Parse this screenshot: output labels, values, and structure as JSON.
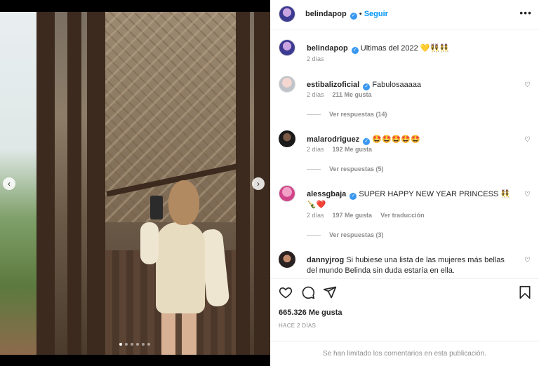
{
  "post": {
    "username": "belindapop",
    "follow_label": "Seguir",
    "more_label": "•••",
    "caption": "Ultimas del 2022 💛👯‍♀️👯",
    "caption_age": "2 días"
  },
  "carousel": {
    "dots": 6,
    "active_dot": 0
  },
  "comments": [
    {
      "username": "estibalizoficial",
      "verified": true,
      "text": "Fabulosaaaaa",
      "age": "2 días",
      "likes": "211 Me gusta",
      "translate": "",
      "replies": "Ver respuestas (14)"
    },
    {
      "username": "malarodriguez",
      "verified": true,
      "text": "🤩🤩🤩🤩🤩",
      "age": "2 días",
      "likes": "192 Me gusta",
      "translate": "",
      "replies": "Ver respuestas (5)"
    },
    {
      "username": "alessgbaja",
      "verified": true,
      "text": "SUPER HAPPY NEW YEAR PRINCESS 👯🍾❤️",
      "age": "2 días",
      "likes": "197 Me gusta",
      "translate": "Ver traducción",
      "replies": "Ver respuestas (3)"
    },
    {
      "username": "dannyjrog",
      "verified": false,
      "text": "Si hubiese una lista de las mujeres más bellas del mundo Belinda sin duda estaría en ella.",
      "age": "",
      "likes": "",
      "translate": "",
      "replies": ""
    }
  ],
  "footer": {
    "likes": "665.326 Me gusta",
    "ago": "HACE 2 DÍAS",
    "limited": "Se han limitado los comentarios en esta publicación."
  },
  "icons": {
    "like": "heart-outline",
    "comment": "speech-bubble",
    "share": "paper-plane",
    "save": "bookmark",
    "verified": "check-badge"
  },
  "colors": {
    "accent": "#0095f6",
    "verified": "#3897f0",
    "muted": "#8e8e8e"
  }
}
